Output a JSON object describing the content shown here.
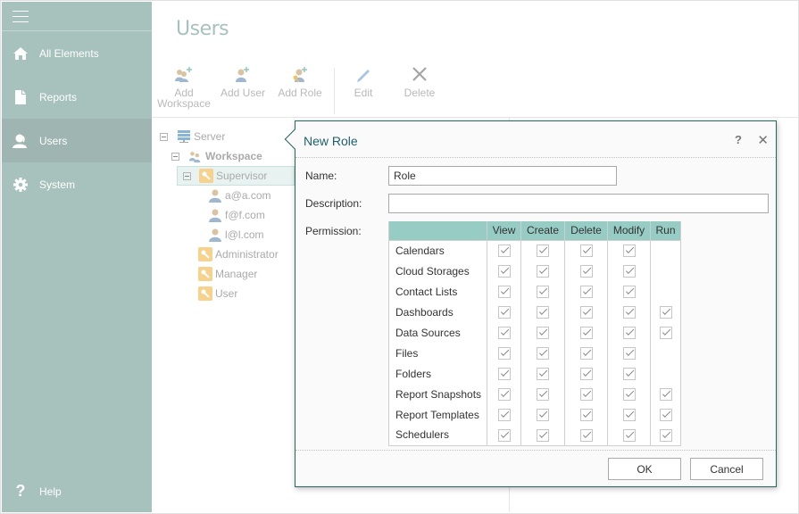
{
  "sidebar": {
    "menu_icon": "hamburger-icon",
    "items": [
      {
        "label": "All Elements",
        "icon": "home-icon",
        "active": false
      },
      {
        "label": "Reports",
        "icon": "document-icon",
        "active": false
      },
      {
        "label": "Users",
        "icon": "users-icon",
        "active": true
      },
      {
        "label": "System",
        "icon": "gear-icon",
        "active": false
      }
    ],
    "help": {
      "label": "Help",
      "icon": "question-icon"
    }
  },
  "page": {
    "title": "Users"
  },
  "toolbar": {
    "add_workspace": "Add Workspace",
    "add_workspace_line1": "Add",
    "add_workspace_line2": "Workspace",
    "add_user": "Add User",
    "add_role": "Add Role",
    "edit": "Edit",
    "delete": "Delete"
  },
  "tree": {
    "server": "Server",
    "workspace": "Workspace",
    "roles": [
      {
        "label": "Supervisor",
        "selected": true,
        "expanded": true,
        "users": [
          "a@a.com",
          "f@f.com",
          "l@l.com"
        ]
      },
      {
        "label": "Administrator",
        "selected": false
      },
      {
        "label": "Manager",
        "selected": false
      },
      {
        "label": "User",
        "selected": false
      }
    ]
  },
  "dialog": {
    "title": "New Role",
    "help_label": "?",
    "close_label": "✕",
    "name_label": "Name:",
    "name_value": "Role",
    "description_label": "Description:",
    "description_value": "",
    "permission_label": "Permission:",
    "columns": [
      "View",
      "Create",
      "Delete",
      "Modify",
      "Run"
    ],
    "rows": [
      {
        "name": "Calendars",
        "perms": [
          true,
          true,
          true,
          true,
          null
        ]
      },
      {
        "name": "Cloud Storages",
        "perms": [
          true,
          true,
          true,
          true,
          null
        ]
      },
      {
        "name": "Contact Lists",
        "perms": [
          true,
          true,
          true,
          true,
          null
        ]
      },
      {
        "name": "Dashboards",
        "perms": [
          true,
          true,
          true,
          true,
          true
        ]
      },
      {
        "name": "Data Sources",
        "perms": [
          true,
          true,
          true,
          true,
          true
        ]
      },
      {
        "name": "Files",
        "perms": [
          true,
          true,
          true,
          true,
          null
        ]
      },
      {
        "name": "Folders",
        "perms": [
          true,
          true,
          true,
          true,
          null
        ]
      },
      {
        "name": "Report Snapshots",
        "perms": [
          true,
          true,
          true,
          true,
          true
        ]
      },
      {
        "name": "Report Templates",
        "perms": [
          true,
          true,
          true,
          true,
          true
        ]
      },
      {
        "name": "Schedulers",
        "perms": [
          true,
          true,
          true,
          true,
          true
        ]
      }
    ],
    "ok_label": "OK",
    "cancel_label": "Cancel"
  }
}
